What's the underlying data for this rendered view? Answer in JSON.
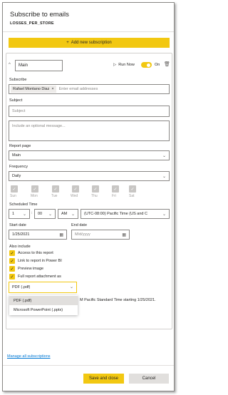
{
  "header": {
    "title": "Subscribe to emails",
    "subtitle": "LOSSES_PER_STORE"
  },
  "add_subscription_label": "Add new subscription",
  "subscription": {
    "name_value": "Main",
    "run_now_label": "Run Now",
    "toggle_label": "On",
    "toggle_on": true,
    "subscribe_label": "Subscribe",
    "recipient_chip": "Rafael Montano Diaz",
    "recipient_placeholder": "Enter email addresses",
    "subject_label": "Subject",
    "subject_placeholder": "Subject",
    "message_placeholder": "Include an optional message...",
    "report_page_label": "Report page",
    "report_page_value": "Main",
    "frequency_label": "Frequency",
    "frequency_value": "Daily",
    "days": [
      "Sun",
      "Mon",
      "Tue",
      "Wed",
      "Thu",
      "Fri",
      "Sat"
    ],
    "scheduled_time_label": "Scheduled Time",
    "time_hour": "1",
    "time_minute": "00",
    "time_ampm": "AM",
    "timezone": "(UTC-08:00) Pacific Time (US and C",
    "start_date_label": "Start date",
    "start_date_value": "1/25/2021",
    "end_date_label": "End date",
    "end_date_placeholder": "M/d/yyyy",
    "also_include_label": "Also include",
    "include_options": [
      "Access to this report",
      "Link to report in Power BI",
      "Preview image",
      "Full report attachment as"
    ],
    "attachment_value": "PDF (.pdf)",
    "attachment_options": [
      "PDF (.pdf)",
      "Microsoft PowerPoint (.pptx)"
    ],
    "schedule_summary_fragment": "M Pacific Standard Time starting 1/25/2021."
  },
  "footer": {
    "manage_link": "Manage all subscriptions",
    "save_label": "Save and close",
    "cancel_label": "Cancel"
  },
  "colors": {
    "accent": "#f2c811",
    "link": "#0078d4",
    "border": "#8a8886"
  }
}
